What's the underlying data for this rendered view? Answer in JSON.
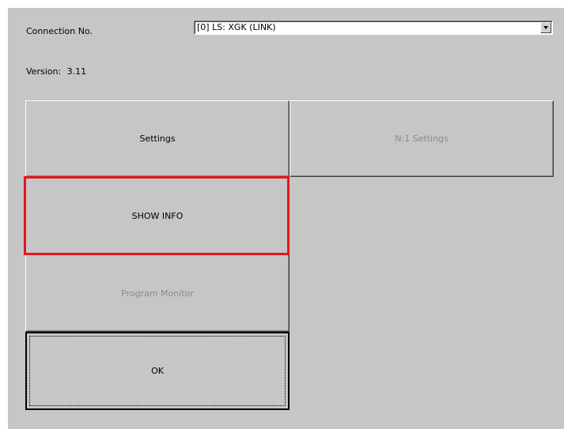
{
  "connection": {
    "label": "Connection No.",
    "selected": "[0] LS: XGK (LINK)"
  },
  "version": {
    "label": "Version:",
    "value": "3.11"
  },
  "buttons": {
    "settings": "Settings",
    "n1_settings": "N:1 Settings",
    "show_info": "SHOW INFO",
    "program_monitor": "Program Monitor",
    "ok": "OK"
  },
  "colors": {
    "background": "#c6c6c6",
    "highlight": "#e8141e"
  },
  "icons": {
    "dropdown": "chevron-down-icon"
  }
}
